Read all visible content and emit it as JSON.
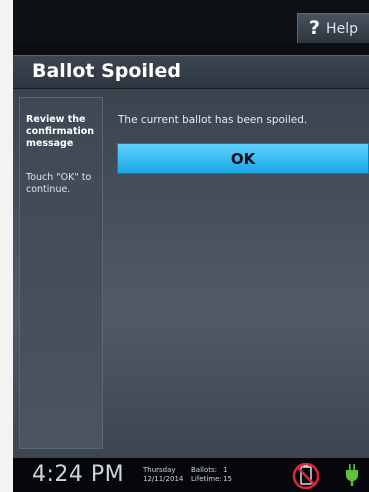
{
  "help": {
    "label": "Help",
    "icon": "question-icon"
  },
  "page": {
    "title": "Ballot Spoiled"
  },
  "sidebar": {
    "heading": "Review the confirmation message",
    "instruction": "Touch \"OK\" to continue."
  },
  "content": {
    "message": "The current ballot has been spoiled.",
    "ok_label": "OK"
  },
  "status": {
    "time": "4:24 PM",
    "day": "Thursday",
    "date": "12/11/2014",
    "ballots_label": "Ballots:",
    "ballots_value": "1",
    "lifetime_label": "Lifetime:",
    "lifetime_value": "15",
    "icons": [
      "no-printer-icon",
      "power-plug-icon"
    ]
  },
  "colors": {
    "accent": "#19a6e6",
    "alert": "#e0283a",
    "power": "#5ec23a"
  }
}
